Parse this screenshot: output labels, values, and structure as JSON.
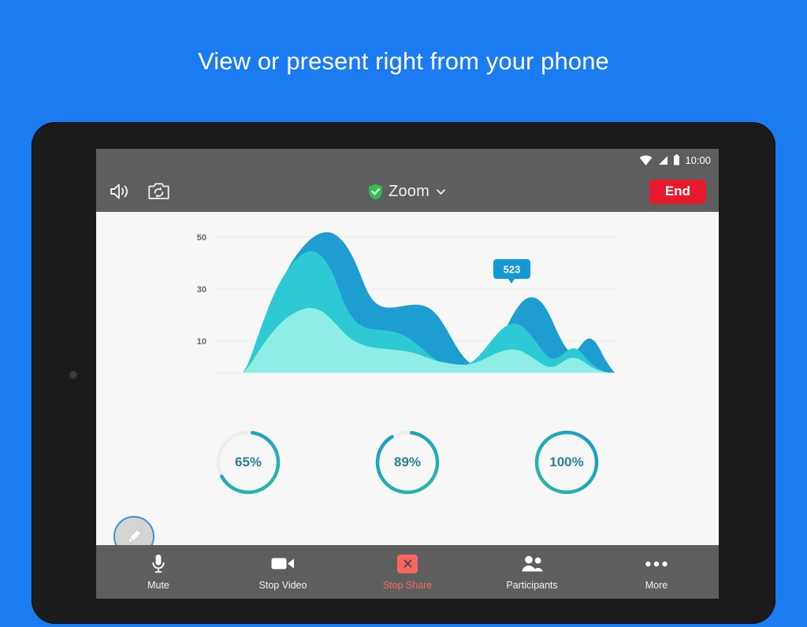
{
  "headline": "View or present right from your phone",
  "theme": {
    "page_background": "#1a7cf0",
    "bezel": "#1b1b1b",
    "screen_background": "#f7f7f7",
    "bar_gray": "#5e5e5e",
    "end_red": "#e8192c",
    "share_red": "#f5665f",
    "accent_blue": "#1E9DD0",
    "accent_teal": "#2DCAD5",
    "accent_cyan": "#8EEDE4",
    "donut_text": "#2a7f96",
    "fab_border": "#3d8fe0"
  },
  "status_bar": {
    "time": "10:00",
    "icons": [
      "wifi-icon",
      "cellular-signal-icon",
      "battery-icon"
    ]
  },
  "app_header": {
    "speaker_icon": "speaker-icon",
    "switch_camera_icon": "switch-camera-icon",
    "shield_icon": "shield-check-icon",
    "title": "Zoom",
    "chevron_icon": "chevron-down-icon",
    "end_label": "End"
  },
  "chart_data": {
    "type": "area",
    "title": "",
    "xlabel": "",
    "ylabel": "",
    "grid": true,
    "legend": false,
    "ylim": [
      0,
      60
    ],
    "yticks": [
      10,
      30,
      50
    ],
    "ytick_labels": [
      "10",
      "30",
      "50"
    ],
    "x": [
      0,
      1,
      2,
      3,
      4,
      5,
      6,
      7,
      8,
      9,
      10,
      11,
      12,
      13,
      14,
      15,
      16,
      17,
      18,
      19,
      20
    ],
    "series": [
      {
        "name": "series-back",
        "color": "#1E9DD0",
        "values": [
          0,
          6,
          18,
          34,
          48,
          56,
          52,
          36,
          24,
          22,
          20,
          13,
          6,
          10,
          22,
          32,
          28,
          18,
          13,
          16,
          2
        ]
      },
      {
        "name": "series-mid",
        "color": "#2DCAD5",
        "values": [
          0,
          8,
          26,
          42,
          44,
          36,
          24,
          17,
          14,
          13,
          12,
          9,
          5,
          7,
          14,
          21,
          19,
          13,
          10,
          14,
          2
        ]
      },
      {
        "name": "series-front",
        "color": "#8EEDE4",
        "values": [
          0,
          5,
          11,
          16,
          18,
          15,
          12,
          10,
          10,
          10,
          9,
          7,
          4,
          5,
          7,
          11,
          10,
          7,
          6,
          9,
          1
        ]
      }
    ],
    "annotations": [
      {
        "name": "tooltip",
        "label": "523",
        "x": 15,
        "y": 32,
        "fill": "#139ad6",
        "text_color": "#ffffff"
      }
    ]
  },
  "donuts": [
    {
      "name": "donut-65",
      "label": "65%",
      "value": 65
    },
    {
      "name": "donut-89",
      "label": "89%",
      "value": 89
    },
    {
      "name": "donut-100",
      "label": "100%",
      "value": 100
    }
  ],
  "fab": {
    "icon": "pencil-icon"
  },
  "toolbar": {
    "items": [
      {
        "name": "mute",
        "icon": "microphone-icon",
        "label": "Mute",
        "danger": false
      },
      {
        "name": "stop-video",
        "icon": "video-camera-icon",
        "label": "Stop Video",
        "danger": false
      },
      {
        "name": "stop-share",
        "icon": "close-x-icon",
        "label": "Stop Share",
        "danger": true
      },
      {
        "name": "participants",
        "icon": "participants-icon",
        "label": "Participants",
        "danger": false
      },
      {
        "name": "more",
        "icon": "ellipsis-icon",
        "label": "More",
        "danger": false
      }
    ]
  }
}
